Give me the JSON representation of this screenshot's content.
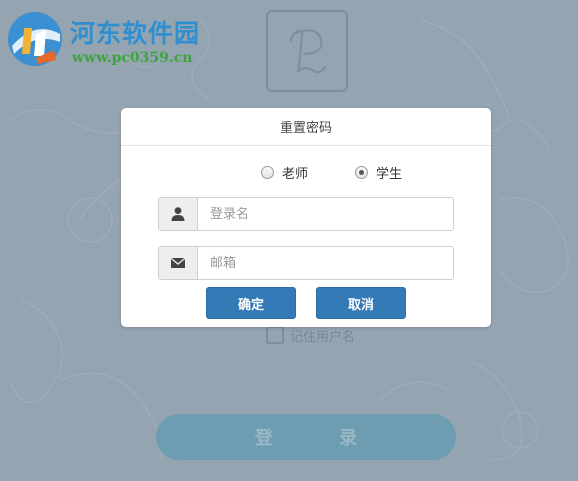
{
  "watermark": {
    "title": "河东软件园",
    "url": "www.pc0359.cn"
  },
  "background": {
    "remember_label": "记住用户名",
    "login_button": "登 录"
  },
  "dialog": {
    "title": "重置密码",
    "roles": [
      {
        "label": "老师",
        "checked": false
      },
      {
        "label": "学生",
        "checked": true
      }
    ],
    "username": {
      "placeholder": "登录名",
      "value": ""
    },
    "email": {
      "placeholder": "邮箱",
      "value": ""
    },
    "confirm_label": "确定",
    "cancel_label": "取消"
  },
  "colors": {
    "backdrop": "#95a4b1",
    "primary_button": "#337ab7",
    "watermark_title": "#2f8fd1",
    "watermark_url": "#3ea53e"
  },
  "icons": {
    "username": "user-icon",
    "email": "envelope-icon"
  }
}
